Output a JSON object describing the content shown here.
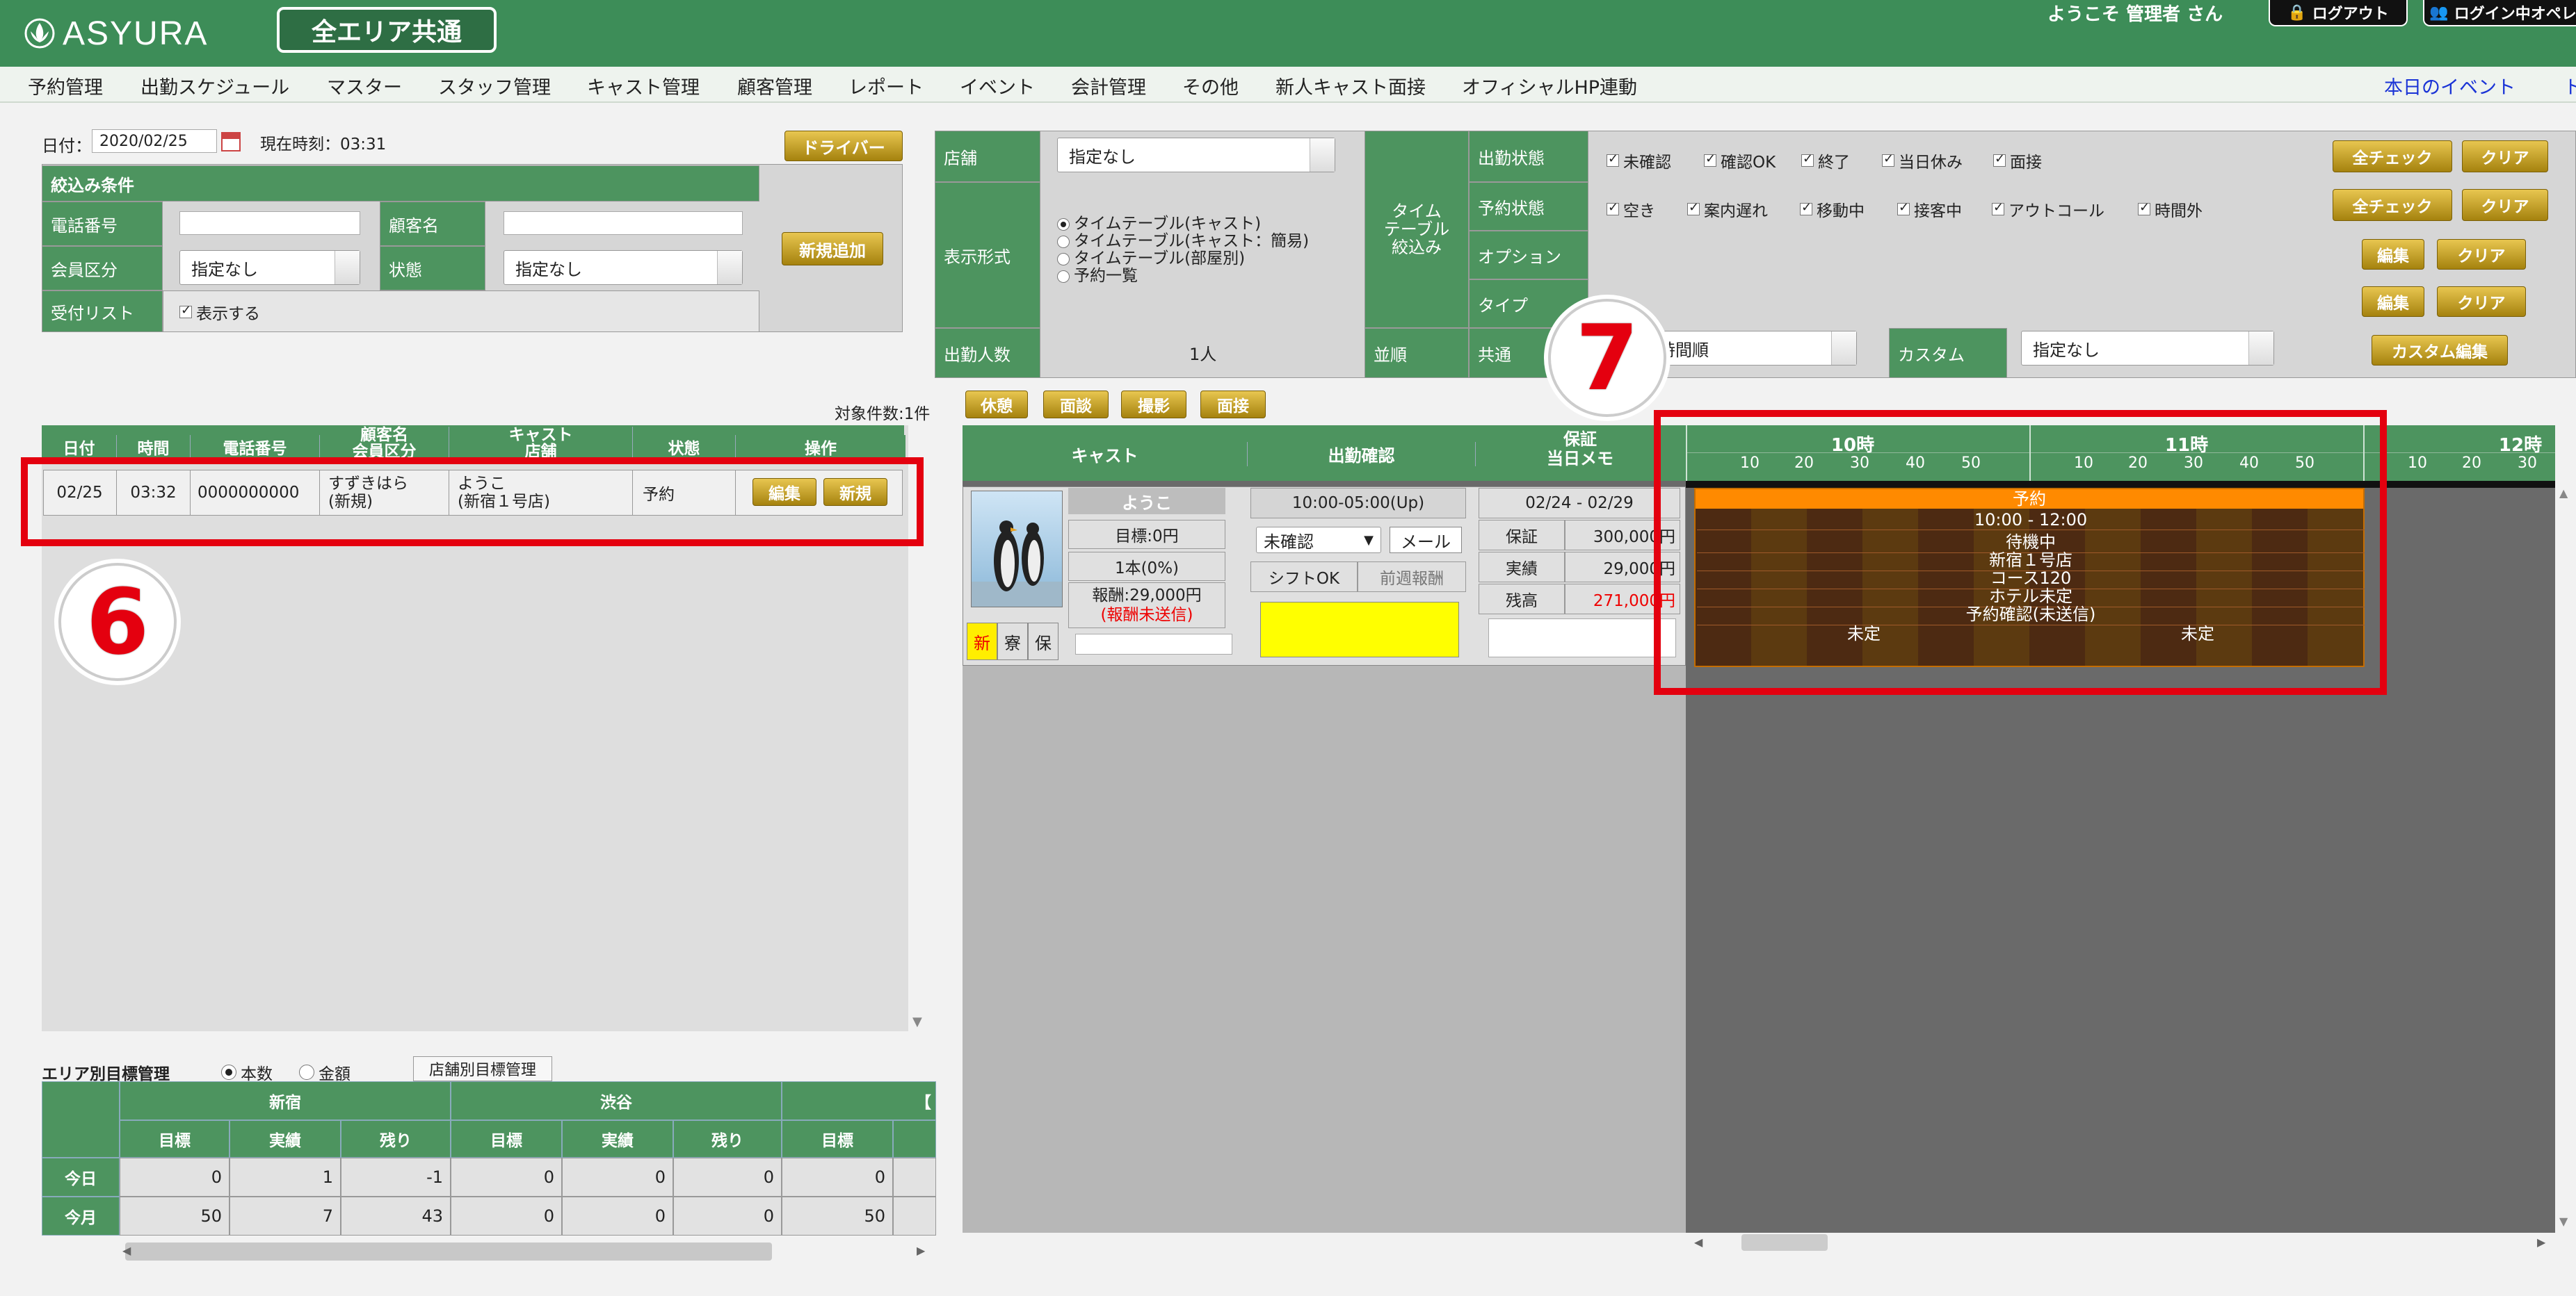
{
  "header": {
    "logo": "ASYURA",
    "area_button": "全エリア共通",
    "welcome": "ようこそ 管理者 さん",
    "logout": "ログアウト",
    "logged_in": "ログイン中オペレ"
  },
  "menu": [
    "予約管理",
    "出勤スケジュール",
    "マスター",
    "スタッフ管理",
    "キャスト管理",
    "顧客管理",
    "レポート",
    "イベント",
    "会計管理",
    "その他",
    "新人キャスト面接",
    "オフィシャルHP連動"
  ],
  "today_event": "本日のイベント",
  "today_event_extra": "ト",
  "left": {
    "date_label": "日付：",
    "date_value": "2020/02/25",
    "now_label": "現在時刻：03:31",
    "driver_btn": "ドライバー",
    "new_btn": "新規追加",
    "filter_title": "絞込み条件",
    "phone_label": "電話番号",
    "customer_label": "顧客名",
    "member_label": "会員区分",
    "member_value": "指定なし",
    "status_label": "状態",
    "status_value": "指定なし",
    "receipt_label": "受付リスト",
    "receipt_check": "表示する",
    "count": "対象件数:1件",
    "cols": [
      "日付",
      "時間",
      "電話番号",
      "顧客名\n会員区分",
      "キャスト\n店舗",
      "状態",
      "操作"
    ],
    "row": {
      "date": "02/25",
      "time": "03:32",
      "phone": "0000000000",
      "customer": "すずきはら",
      "member": "(新規)",
      "cast": "ようこ",
      "shop": "(新宿１号店)",
      "status": "予約",
      "edit": "編集",
      "new": "新規"
    }
  },
  "target": {
    "title": "エリア別目標管理",
    "radio1": "本数",
    "radio2": "金額",
    "shop_btn": "店舗別目標管理",
    "areas": [
      "新宿",
      "渋谷",
      "【"
    ],
    "sub": [
      "目標",
      "実績",
      "残り"
    ],
    "row_labels": [
      "今日",
      "今月"
    ],
    "today": [
      "0",
      "1",
      "-1",
      "0",
      "0",
      "0",
      "0"
    ],
    "month": [
      "50",
      "7",
      "43",
      "0",
      "0",
      "0",
      "50"
    ]
  },
  "filter": {
    "shop_label": "店舗",
    "shop_value": "指定なし",
    "display_label": "表示形式",
    "display_options": [
      "タイムテーブル(キャスト)",
      "タイムテーブル(キャスト：簡易)",
      "タイムテーブル(部屋別)",
      "予約一覧"
    ],
    "count_label": "出勤人数",
    "count_value": "1人",
    "order_label": "並順",
    "tt_label": "タイム\nテーブル\n絞込み",
    "attend_label": "出勤状態",
    "attend": [
      "未確認",
      "確認OK",
      "終了",
      "当日休み",
      "面接"
    ],
    "resv_label": "予約状態",
    "resv": [
      "空き",
      "案内遅れ",
      "移動中",
      "接客中",
      "アウトコール",
      "時間外"
    ],
    "option_label": "オプション",
    "type_label": "タイプ",
    "common_label": "共通",
    "common_value": "出勤時間順",
    "custom_label": "カスタム",
    "custom_value": "指定なし",
    "all_check": "全チェック",
    "clear": "クリア",
    "edit": "編集",
    "custom_edit": "カスタム編集"
  },
  "actions": [
    "休憩",
    "面談",
    "撮影",
    "面接"
  ],
  "timetable": {
    "col_cast": "キャスト",
    "col_attend": "出勤確認",
    "col_memo": "保証\n当日メモ",
    "hours": [
      "10時",
      "11時",
      "12時"
    ],
    "minutes": [
      "10",
      "20",
      "30",
      "40",
      "50"
    ],
    "cast": {
      "name": "ようこ",
      "target": "目標:0円",
      "count": "1本(0%)",
      "pay": "報酬:29,000円",
      "pay_note": "(報酬未送信)",
      "tags": [
        "新",
        "寮",
        "保"
      ]
    },
    "attend": {
      "time": "10:00-05:00(Up)",
      "status": "未確認",
      "mail": "メール",
      "shift": "シフトOK",
      "prev": "前週報酬"
    },
    "memo": {
      "period": "02/24 - 02/29",
      "rows": [
        [
          "保証",
          "300,000円"
        ],
        [
          "実績",
          "29,000円"
        ],
        [
          "残高",
          "271,000円"
        ]
      ]
    },
    "booking": {
      "title": "予約",
      "lines": [
        "10:00 - 12:00",
        "待機中",
        "新宿１号店",
        "コース120",
        "ホテル未定",
        "予約確認(未送信)"
      ],
      "left_note": "未定",
      "right_note": "未定"
    }
  },
  "annotations": {
    "six": "6",
    "seven": "7"
  }
}
